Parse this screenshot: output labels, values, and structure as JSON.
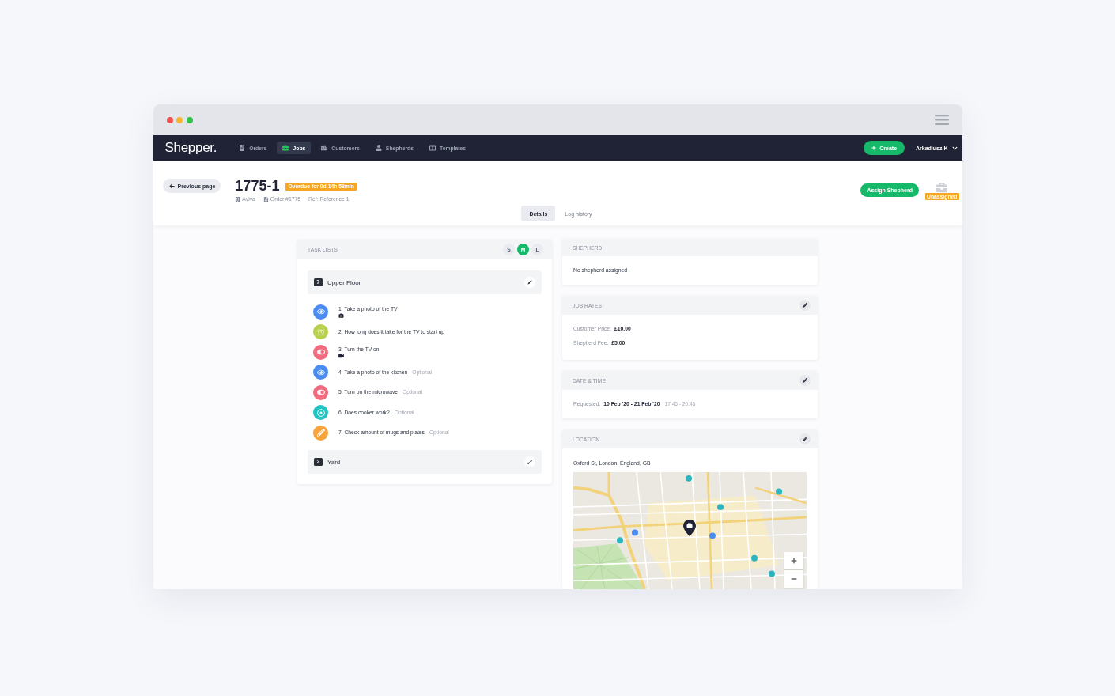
{
  "nav": {
    "logo": "Shepper.",
    "items": [
      {
        "label": "Orders",
        "kind": "orders",
        "selected": false
      },
      {
        "label": "Jobs",
        "kind": "jobs",
        "selected": true
      },
      {
        "label": "Customers",
        "kind": "customers",
        "selected": false
      },
      {
        "label": "Shepherds",
        "kind": "shepherds",
        "selected": false
      },
      {
        "label": "Templates",
        "kind": "templates",
        "selected": false
      }
    ],
    "create_button": "Create",
    "user": "Arkadiusz K"
  },
  "header": {
    "back_button": "Previous page",
    "job_id": "1775-1",
    "overdue_badge": "Overdue for 0d 14h 58min",
    "meta": [
      {
        "kind": "customer",
        "text": "Aviva"
      },
      {
        "kind": "order",
        "text": "Order #1775"
      },
      {
        "kind": "reference",
        "text": "Ref: Reference 1"
      }
    ],
    "assign_button": "Assign Shepherd",
    "status_badge": "Unassigned"
  },
  "tabs": [
    {
      "label": "Details",
      "selected": true
    },
    {
      "label": "Log history",
      "selected": false
    }
  ],
  "task_lists": {
    "title": "TASK LISTS",
    "sizes": [
      {
        "label": "S",
        "selected": false
      },
      {
        "label": "M",
        "selected": true
      },
      {
        "label": "L",
        "selected": false
      }
    ],
    "groups": [
      {
        "count": "7",
        "name": "Upper Floor",
        "expanded": true,
        "tasks": [
          {
            "label": "1. Take a photo of the TV",
            "kind": "photo",
            "color": "#4a8cf0",
            "attachments": [
              {
                "kind": "camera"
              }
            ]
          },
          {
            "label": "2. How long does it take for the TV to start up",
            "kind": "timer",
            "color": "#b7d04c"
          },
          {
            "label": "3. Turn the TV on",
            "kind": "action",
            "color": "#f26b7e",
            "attachments": [
              {
                "kind": "video"
              }
            ]
          },
          {
            "label": "4. Take a photo of the kitchen",
            "kind": "photo",
            "color": "#4a8cf0",
            "tag": "Optional"
          },
          {
            "label": "5. Turn on the microwave",
            "kind": "action",
            "color": "#f26b7e",
            "tag": "Optional"
          },
          {
            "label": "6. Does cooker work?",
            "kind": "check",
            "color": "#22c3c3",
            "tag": "Optional"
          },
          {
            "label": "7. Check amount of mugs and plates",
            "kind": "text",
            "color": "#f8a33c",
            "tag": "Optional"
          }
        ]
      },
      {
        "count": "2",
        "name": "Yard",
        "expanded": false
      }
    ]
  },
  "panels": [
    {
      "kind": "text",
      "title": "SHEPHERD",
      "editable": false,
      "text": "No shepherd assigned"
    },
    {
      "kind": "rates",
      "title": "JOB RATES",
      "editable": true,
      "rows": [
        {
          "label": "Customer Price:",
          "value": "£10.00"
        },
        {
          "label": "Shepherd Fee:",
          "value": "£5.00"
        }
      ]
    },
    {
      "kind": "dates",
      "title": "DATE & TIME",
      "editable": true,
      "label": "Requested:",
      "value": "10 Feb '20 - 21 Feb '20",
      "time": "17:45 - 20:45"
    },
    {
      "kind": "location",
      "title": "LOCATION",
      "editable": true,
      "address": "Oxford St, London, England, GB"
    }
  ]
}
